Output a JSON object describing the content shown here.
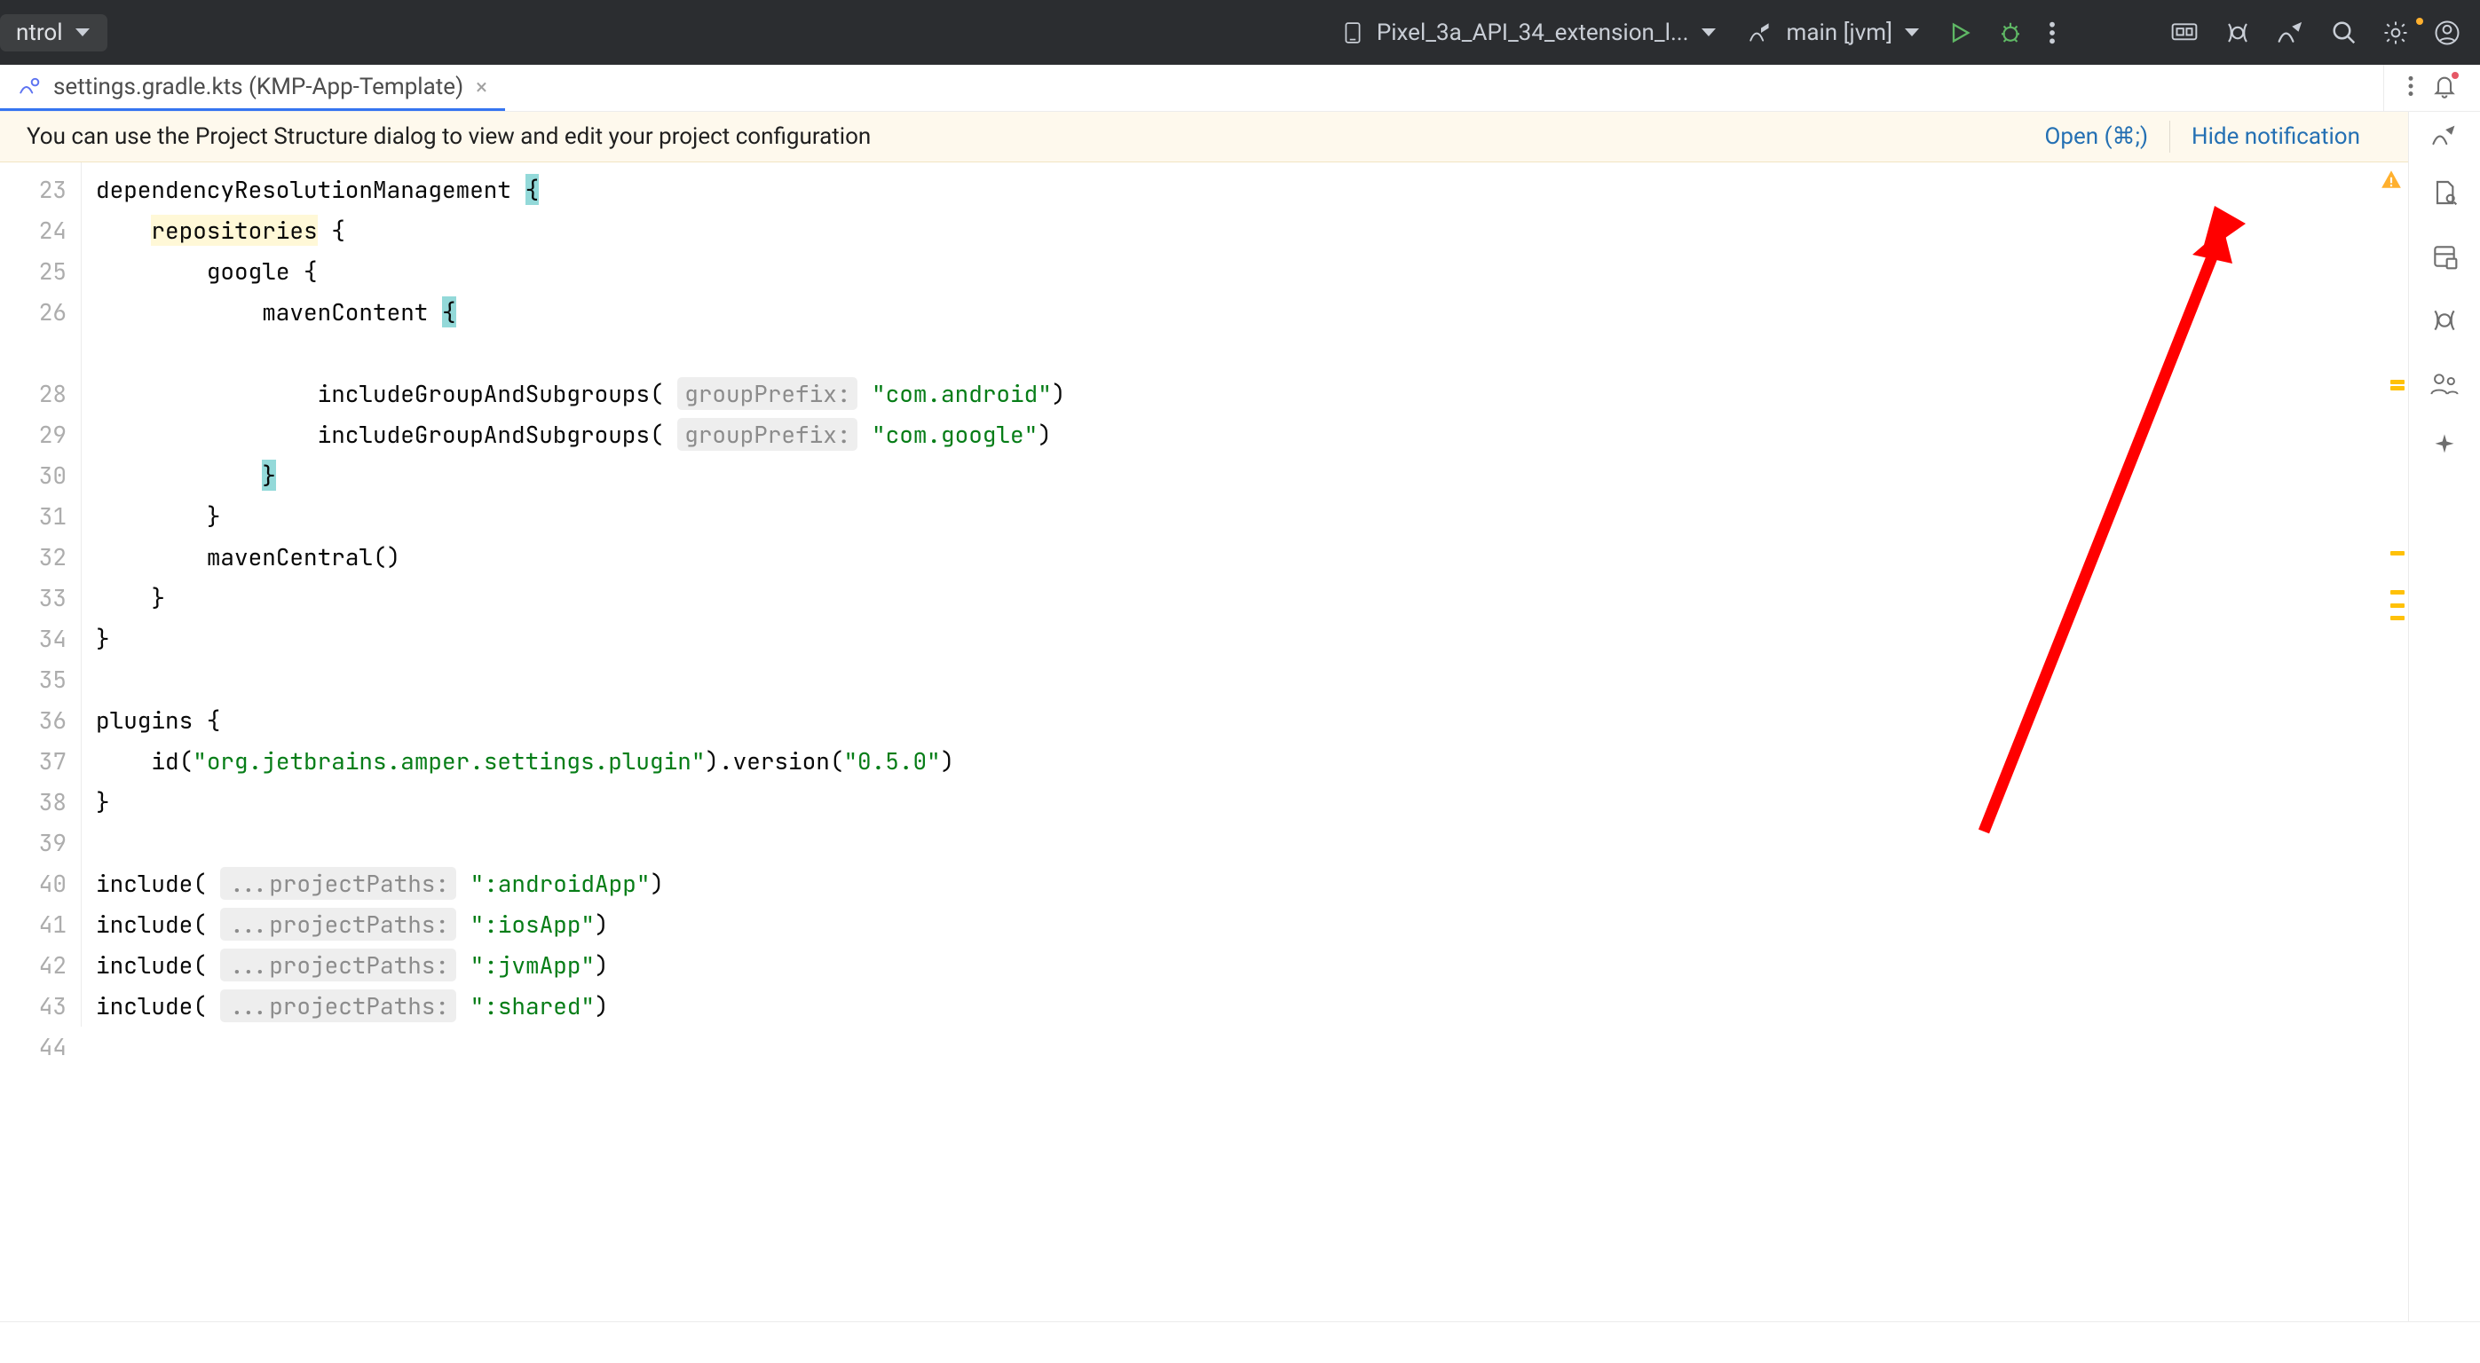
{
  "header": {
    "vc_label": "ntrol",
    "device": "Pixel_3a_API_34_extension_l...",
    "run_config": "main [jvm]"
  },
  "tab": {
    "file": "settings.gradle.kts",
    "context": "(KMP-App-Template)"
  },
  "notification": {
    "message": "You can use the Project Structure dialog to view and edit your project configuration",
    "open_label": "Open (⌘;)",
    "hide_label": "Hide notification"
  },
  "code": {
    "first_line": 23,
    "hint_groupPrefix": "groupPrefix:",
    "hint_projectPaths": "...projectPaths:",
    "l23_a": "dependencyResolutionManagement ",
    "l23_b": "{",
    "l24_a": "repositories",
    "l24_b": " {",
    "l25": "google {",
    "l26_a": "mavenContent ",
    "l26_b": "{",
    "l28_a": "includeGroupAndSubgroups",
    "l28_b": "( ",
    "l28_c": "\"com.android\"",
    "l28_d": ")",
    "l29_c": "\"com.google\"",
    "l30": "}",
    "l31": "}",
    "l32": "mavenCentral()",
    "l33": "}",
    "l34": "}",
    "l36": "plugins {",
    "l37_a": "id(",
    "l37_b": "\"org.jetbrains.amper.settings.plugin\"",
    "l37_c": ").version(",
    "l37_d": "\"0.5.0\"",
    "l37_e": ")",
    "l38": "}",
    "l40": "include( ",
    "l40_s": "\":androidApp\"",
    "l41_s": "\":iosApp\"",
    "l42_s": "\":jvmApp\"",
    "l43_s": "\":shared\"",
    "inc_tail": ")"
  },
  "markers": [
    {
      "top_pct": 25.2,
      "cls": "double"
    },
    {
      "top_pct": 45.0,
      "cls": ""
    },
    {
      "top_pct": 49.5,
      "cls": ""
    },
    {
      "top_pct": 51.0,
      "cls": ""
    },
    {
      "top_pct": 52.5,
      "cls": ""
    }
  ]
}
